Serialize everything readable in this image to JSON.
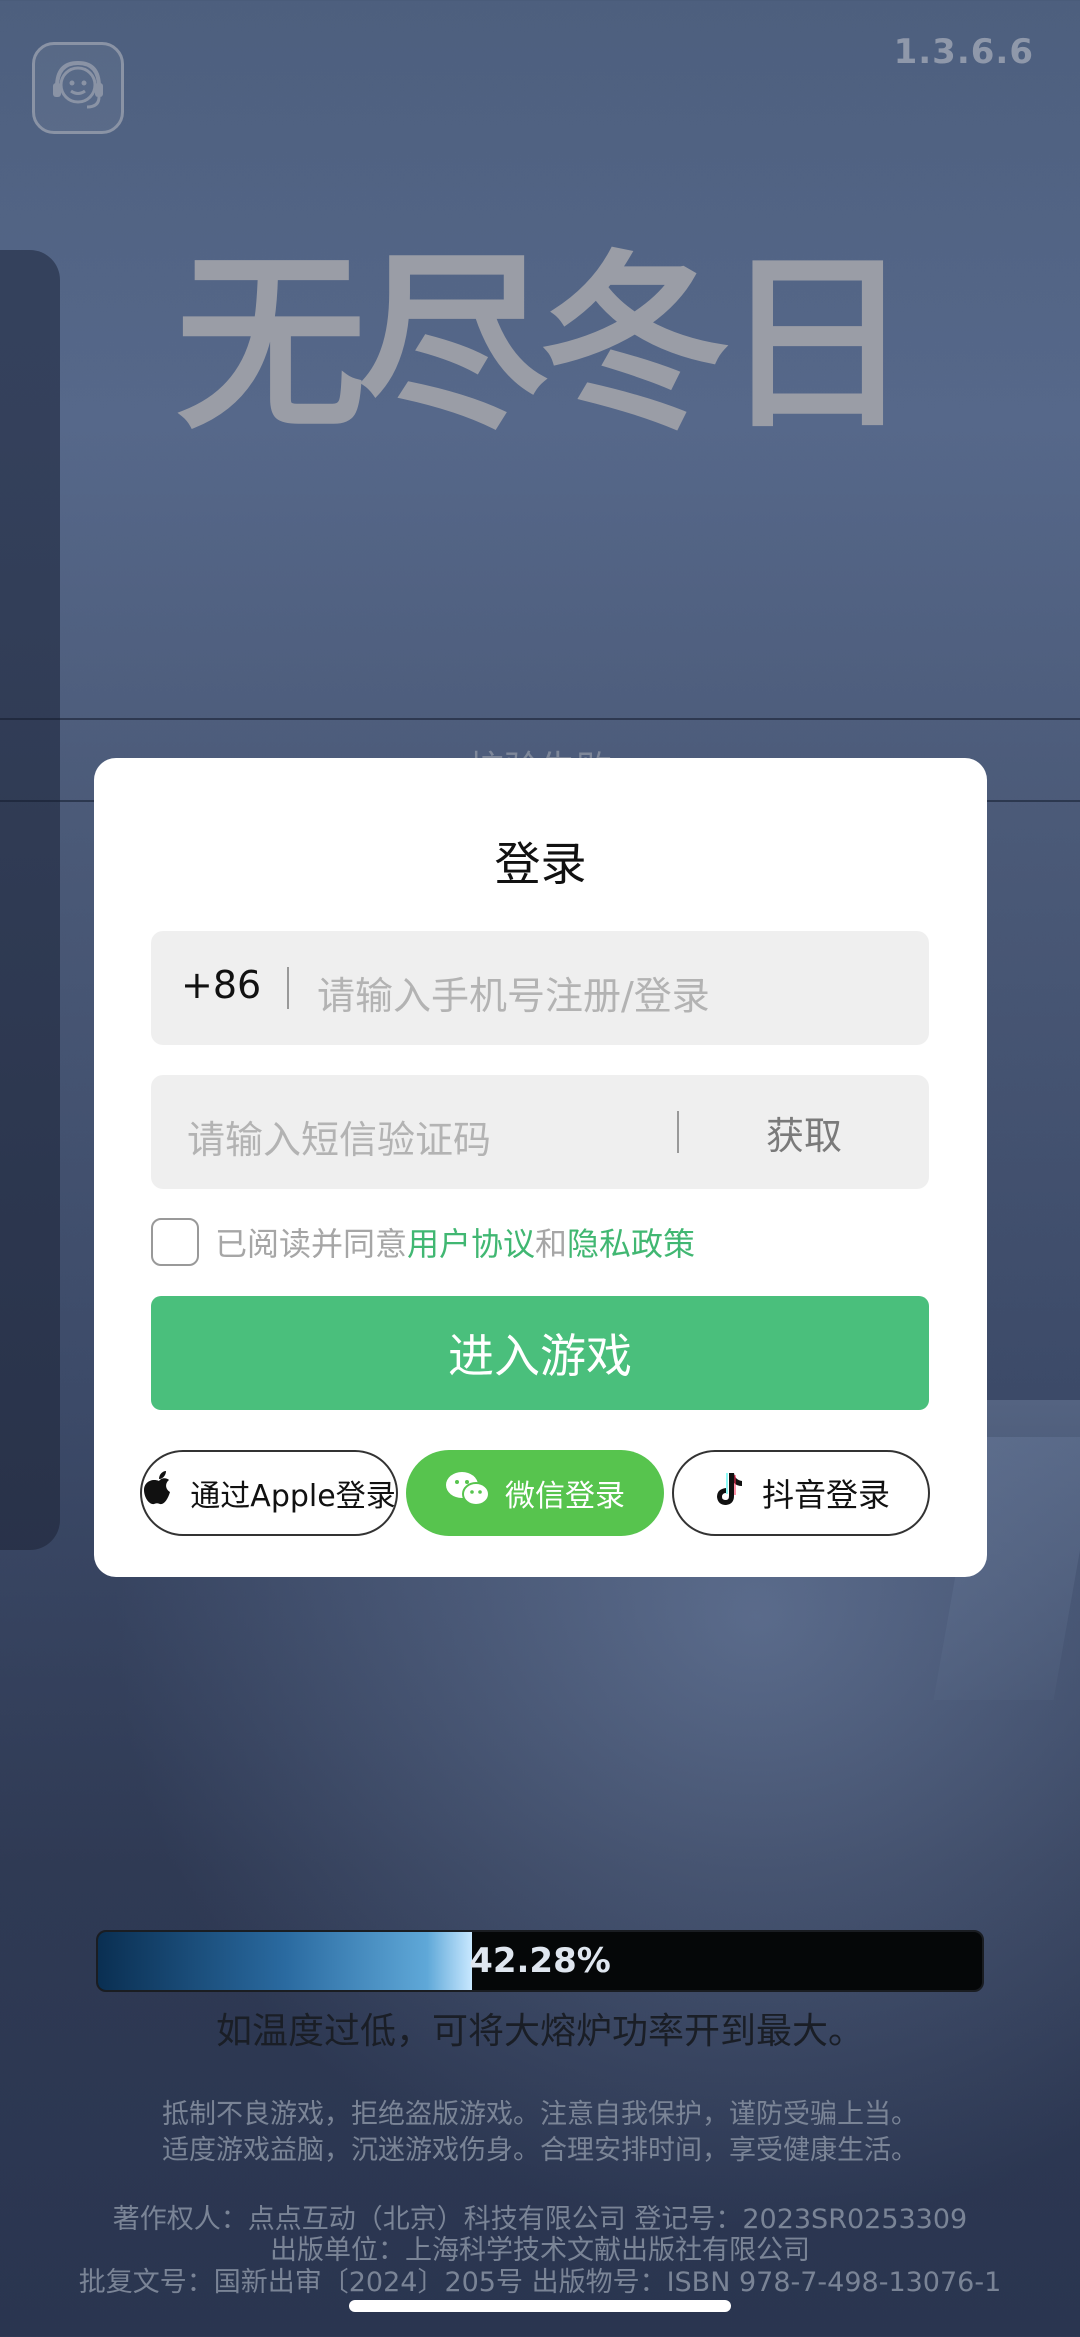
{
  "version": "1.3.6.6",
  "logo_text": "无尽冬日",
  "background_status": "校验失败",
  "dialog": {
    "title": "登录",
    "phone_prefix": "+86",
    "phone_placeholder": "请输入手机号注册/登录",
    "sms_placeholder": "请输入短信验证码",
    "get_code_label": "获取",
    "agree_prefix": "已阅读并同意",
    "user_agreement": "用户协议",
    "and": "和",
    "privacy_policy": "隐私政策",
    "enter_label": "进入游戏",
    "apple_label": "通过Apple登录",
    "wechat_label": "微信登录",
    "douyin_label": "抖音登录"
  },
  "progress": {
    "percent_text": "42.28%",
    "fraction": 0.4228
  },
  "tip": "如温度过低，可将大熔炉功率开到最大。",
  "health_notice": [
    "抵制不良游戏，拒绝盗版游戏。注意自我保护，谨防受骗上当。",
    "适度游戏益脑，沉迷游戏伤身。合理安排时间，享受健康生活。"
  ],
  "copyright": [
    "著作权人：点点互动（北京）科技有限公司  登记号：2023SR0253309",
    "出版单位：上海科学技术文献出版社有限公司",
    "批复文号：国新出审〔2024〕205号  出版物号：ISBN 978-7-498-13076-1"
  ],
  "colors": {
    "accent_green": "#4abf7c",
    "wechat_green": "#57c44e",
    "link_green": "#41b772"
  }
}
